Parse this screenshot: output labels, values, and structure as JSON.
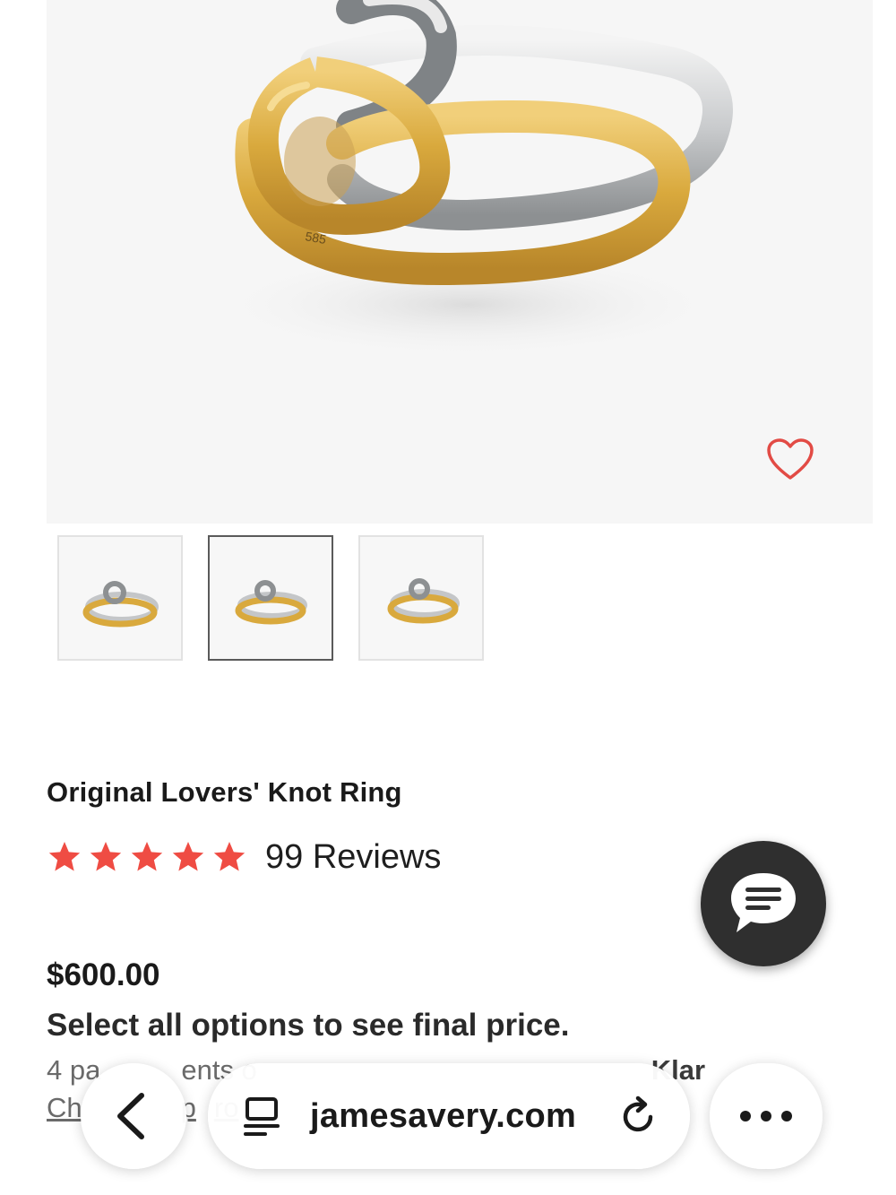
{
  "product": {
    "title": "Original Lovers' Knot Ring",
    "rating": 5,
    "max_rating": 5,
    "reviews_label": "99 Reviews",
    "price": "$600.00",
    "price_note": "Select all options to see final price.",
    "klarna_prefix": "4 pa",
    "klarna_mid": "ents o",
    "klarna_brand": "Klar",
    "checkout_partial_a": "Ch",
    "checkout_partial_b": "p",
    "checkout_partial_c": "ro"
  },
  "gallery": {
    "selected_index": 1,
    "thumbnail_count": 3,
    "stamp": "585"
  },
  "browser": {
    "url": "jamesavery.com"
  },
  "colors": {
    "star": "#ef4c43",
    "heart": "#e24b45",
    "chat_bg": "#2f2f2f",
    "gold": "#d9a93d",
    "silver": "#c9cbcd"
  },
  "icons": {
    "wishlist": "heart-outline-icon",
    "star": "star-icon",
    "chat": "chat-bubble-icon",
    "back": "chevron-left-icon",
    "tabs": "tabs-icon",
    "reload": "reload-icon",
    "more": "ellipsis-icon"
  }
}
